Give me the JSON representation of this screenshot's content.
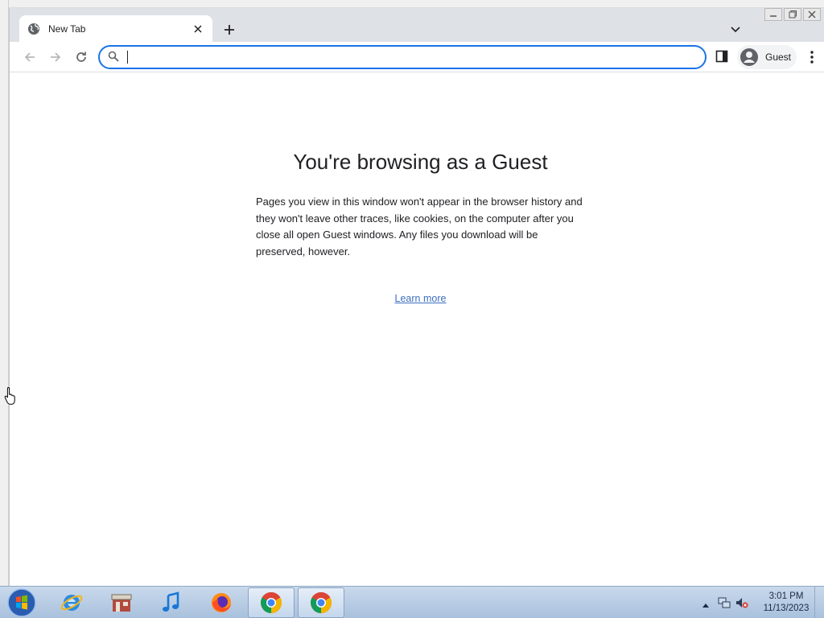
{
  "browser": {
    "tab": {
      "title": "New Tab",
      "favicon_icon": "globe-icon",
      "close_icon": "close-icon"
    },
    "newtab_icon": "plus-icon",
    "tabsearch_icon": "chevron-down-icon",
    "toolbar": {
      "back_icon": "back-arrow-icon",
      "forward_icon": "forward-arrow-icon",
      "reload_icon": "reload-icon",
      "omnibox": {
        "value": "",
        "placeholder": "",
        "search_icon": "search-icon"
      },
      "sidepanel_icon": "side-panel-icon",
      "profile": {
        "label": "Guest",
        "icon": "avatar-icon"
      },
      "menu_icon": "kebab-menu-icon"
    }
  },
  "guest_page": {
    "heading": "You're browsing as a Guest",
    "description": "Pages you view in this window won't appear in the browser history and they won't leave other traces, like cookies, on the computer after you close all open Guest windows. Any files you download will be preserved, however.",
    "learn_more": "Learn more"
  },
  "taskbar": {
    "start_icon": "windows-start-icon",
    "items": [
      {
        "name": "internet-explorer-icon"
      },
      {
        "name": "store-icon"
      },
      {
        "name": "music-icon"
      },
      {
        "name": "firefox-icon"
      },
      {
        "name": "chrome-icon"
      },
      {
        "name": "chrome-icon"
      }
    ],
    "tray": {
      "time": "3:01 PM",
      "date": "11/13/2023"
    }
  },
  "colors": {
    "accent": "#1a73e8",
    "tabstrip": "#dee1e6",
    "link": "#3c6fbf"
  }
}
